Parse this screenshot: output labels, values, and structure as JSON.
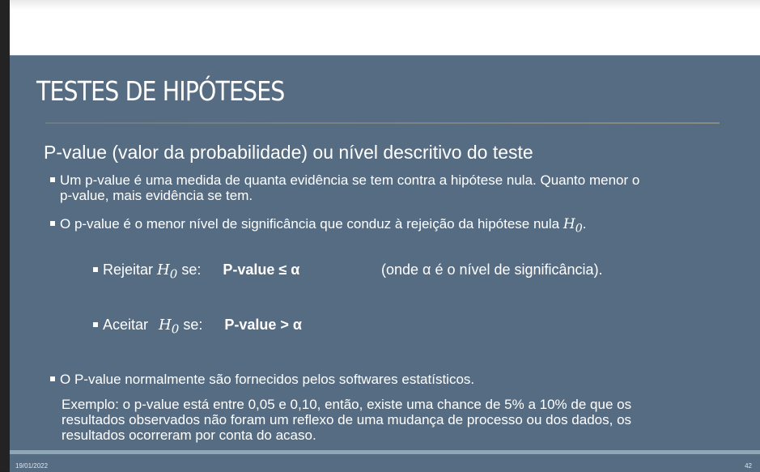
{
  "slide": {
    "title": "TESTES DE HIPÓTESES",
    "subtitle": "P-value (valor da probabilidade) ou nível descritivo do teste",
    "bullet1_line1": "Um p-value é uma medida de quanta evidência se tem contra a hipótese nula. Quanto menor o",
    "bullet1_line2": "p-value, mais evidência se tem.",
    "bullet2": "O p-value é o menor nível de significância que conduz à rejeição da hipótese nula",
    "bullet2_math": "H",
    "sub0": "0",
    "reject_label": "Rejeitar",
    "se": "se:",
    "reject_rule": "P-value ≤  α",
    "reject_note": "(onde α é o nível de significância).",
    "accept_label": "Aceitar",
    "accept_rule": "P-value > α",
    "bullet3": "O P-value normalmente são fornecidos pelos softwares estatísticos.",
    "example_line1": "Exemplo: o p-value está entre 0,05 e 0,10, então, existe uma chance de 5% a 10% de que os",
    "example_line2": "resultados observados não foram um reflexo de uma mudança de processo ou dos dados, os",
    "example_line3": "resultados ocorreram por conta do acaso.",
    "date": "19/01/2022",
    "page": "42"
  },
  "colors": {
    "background": "#566c82",
    "band": "#8fa6b6"
  }
}
